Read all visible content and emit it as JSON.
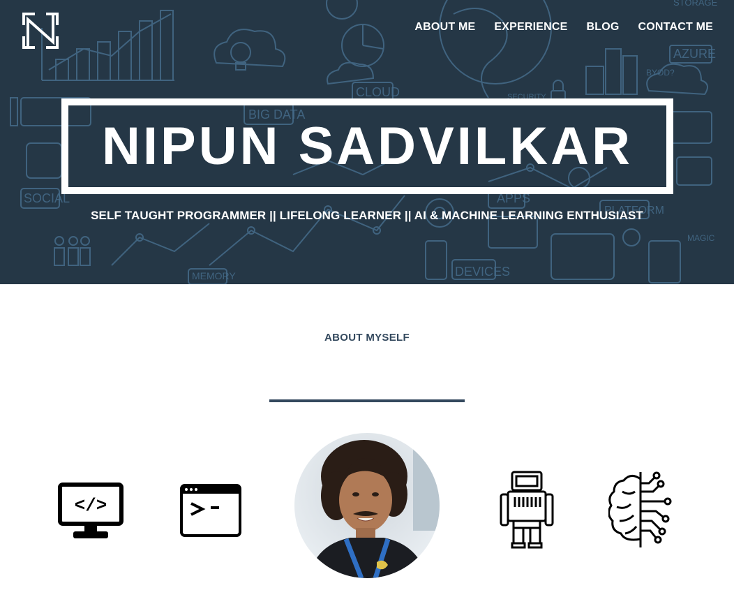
{
  "nav": {
    "items": [
      {
        "label": "ABOUT ME"
      },
      {
        "label": "EXPERIENCE"
      },
      {
        "label": "BLOG"
      },
      {
        "label": "CONTACT ME"
      }
    ]
  },
  "hero": {
    "name": "NIPUN SADVILKAR",
    "tagline": "SELF TAUGHT PROGRAMMER || LIFELONG LEARNER || AI & MACHINE LEARNING ENTHUSIAST",
    "doodle_words": [
      "BIG DATA",
      "CLOUD",
      "SOCIAL",
      "AZURE",
      "APPS",
      "DEVICES",
      "MEMORY",
      "PLATFORM",
      "MAGIC",
      "BYOD?",
      "SECURITY",
      "STORAGE"
    ]
  },
  "about": {
    "title": "ABOUT MYSELF",
    "icons": [
      "code-monitor-icon",
      "terminal-icon",
      "robot-icon",
      "ai-brain-icon"
    ]
  },
  "colors": {
    "hero_bg": "#2a3e4e",
    "doodle": "#5b8fb5",
    "heading": "#34495e"
  }
}
